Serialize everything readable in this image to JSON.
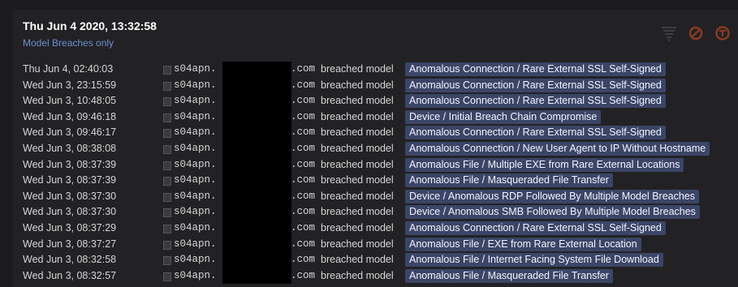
{
  "header": {
    "date": "Thu Jun 4 2020, 13:32:58",
    "filter_label": "Model Breaches only"
  },
  "toolbar": {
    "icons": [
      "filter-icon",
      "cancel-icon",
      "model-icon"
    ],
    "accent": "#e0552a"
  },
  "breaches": [
    {
      "time": "Thu Jun 4, 02:40:03",
      "host": "s04apn.",
      "domain": ".com",
      "action": "breached model",
      "model": "Anomalous Connection / Rare External SSL Self-Signed"
    },
    {
      "time": "Wed Jun 3, 23:15:59",
      "host": "s04apn.",
      "domain": ".com",
      "action": "breached model",
      "model": "Anomalous Connection / Rare External SSL Self-Signed"
    },
    {
      "time": "Wed Jun 3, 10:48:05",
      "host": "s04apn.",
      "domain": ".com",
      "action": "breached model",
      "model": "Anomalous Connection / Rare External SSL Self-Signed"
    },
    {
      "time": "Wed Jun 3, 09:46:18",
      "host": "s04apn.",
      "domain": ".com",
      "action": "breached model",
      "model": "Device / Initial Breach Chain Compromise"
    },
    {
      "time": "Wed Jun 3, 09:46:17",
      "host": "s04apn.",
      "domain": ".com",
      "action": "breached model",
      "model": "Anomalous Connection / Rare External SSL Self-Signed"
    },
    {
      "time": "Wed Jun 3, 08:38:08",
      "host": "s04apn.",
      "domain": ".com",
      "action": "breached model",
      "model": "Anomalous Connection / New User Agent to IP Without Hostname"
    },
    {
      "time": "Wed Jun 3, 08:37:39",
      "host": "s04apn.",
      "domain": ".com",
      "action": "breached model",
      "model": "Anomalous File / Multiple EXE from Rare External Locations"
    },
    {
      "time": "Wed Jun 3, 08:37:39",
      "host": "s04apn.",
      "domain": ".com",
      "action": "breached model",
      "model": "Anomalous File / Masqueraded File Transfer"
    },
    {
      "time": "Wed Jun 3, 08:37:30",
      "host": "s04apn.",
      "domain": ".com",
      "action": "breached model",
      "model": "Device / Anomalous RDP Followed By Multiple Model Breaches"
    },
    {
      "time": "Wed Jun 3, 08:37:30",
      "host": "s04apn.",
      "domain": ".com",
      "action": "breached model",
      "model": "Device / Anomalous SMB Followed By Multiple Model Breaches"
    },
    {
      "time": "Wed Jun 3, 08:37:29",
      "host": "s04apn.",
      "domain": ".com",
      "action": "breached model",
      "model": "Anomalous Connection / Rare External SSL Self-Signed"
    },
    {
      "time": "Wed Jun 3, 08:37:27",
      "host": "s04apn.",
      "domain": ".com",
      "action": "breached model",
      "model": "Anomalous File / EXE from Rare External Location"
    },
    {
      "time": "Wed Jun 3, 08:32:58",
      "host": "s04apn.",
      "domain": ".com",
      "action": "breached model",
      "model": "Anomalous File / Internet Facing System File Download"
    },
    {
      "time": "Wed Jun 3, 08:32:57",
      "host": "s04apn.",
      "domain": ".com",
      "action": "breached model",
      "model": "Anomalous File / Masqueraded File Transfer"
    }
  ]
}
